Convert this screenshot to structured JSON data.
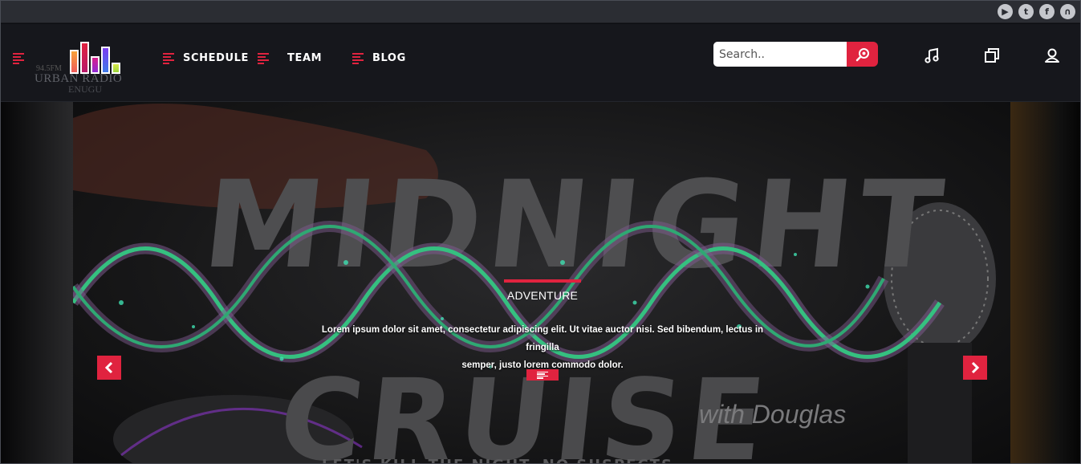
{
  "social": [
    "youtube-icon",
    "twitter-icon",
    "facebook-icon",
    "headphones-icon"
  ],
  "logo": {
    "frequency": "94.5FM",
    "name": "URBAN RADIO",
    "city": "ENUGU"
  },
  "nav": [
    {
      "label": "SCHEDULE"
    },
    {
      "label": "TEAM"
    },
    {
      "label": "BLOG"
    }
  ],
  "search": {
    "placeholder": "Search.."
  },
  "header_icons": [
    "music-note-icon",
    "gallery-icon",
    "user-icon"
  ],
  "slide": {
    "poster_title_1": "MIDNIGHT",
    "poster_title_2": "CRUISE",
    "poster_with": "with Douglas",
    "poster_tagline": "LET'S KILL THE NIGHT. NO SUSPECTS",
    "category": "ADVENTURE",
    "description_line1": "Lorem ipsum dolor sit amet, consectetur adipiscing elit. Ut vitae auctor nisi. Sed bibendum, lectus in fringilla",
    "description_line2": "semper, justo lorem commodo dolor."
  },
  "colors": {
    "accent": "#e0233f",
    "header_bg": "#16171c",
    "topbar_bg": "#2b2d33",
    "wave": "#2fb57a"
  }
}
